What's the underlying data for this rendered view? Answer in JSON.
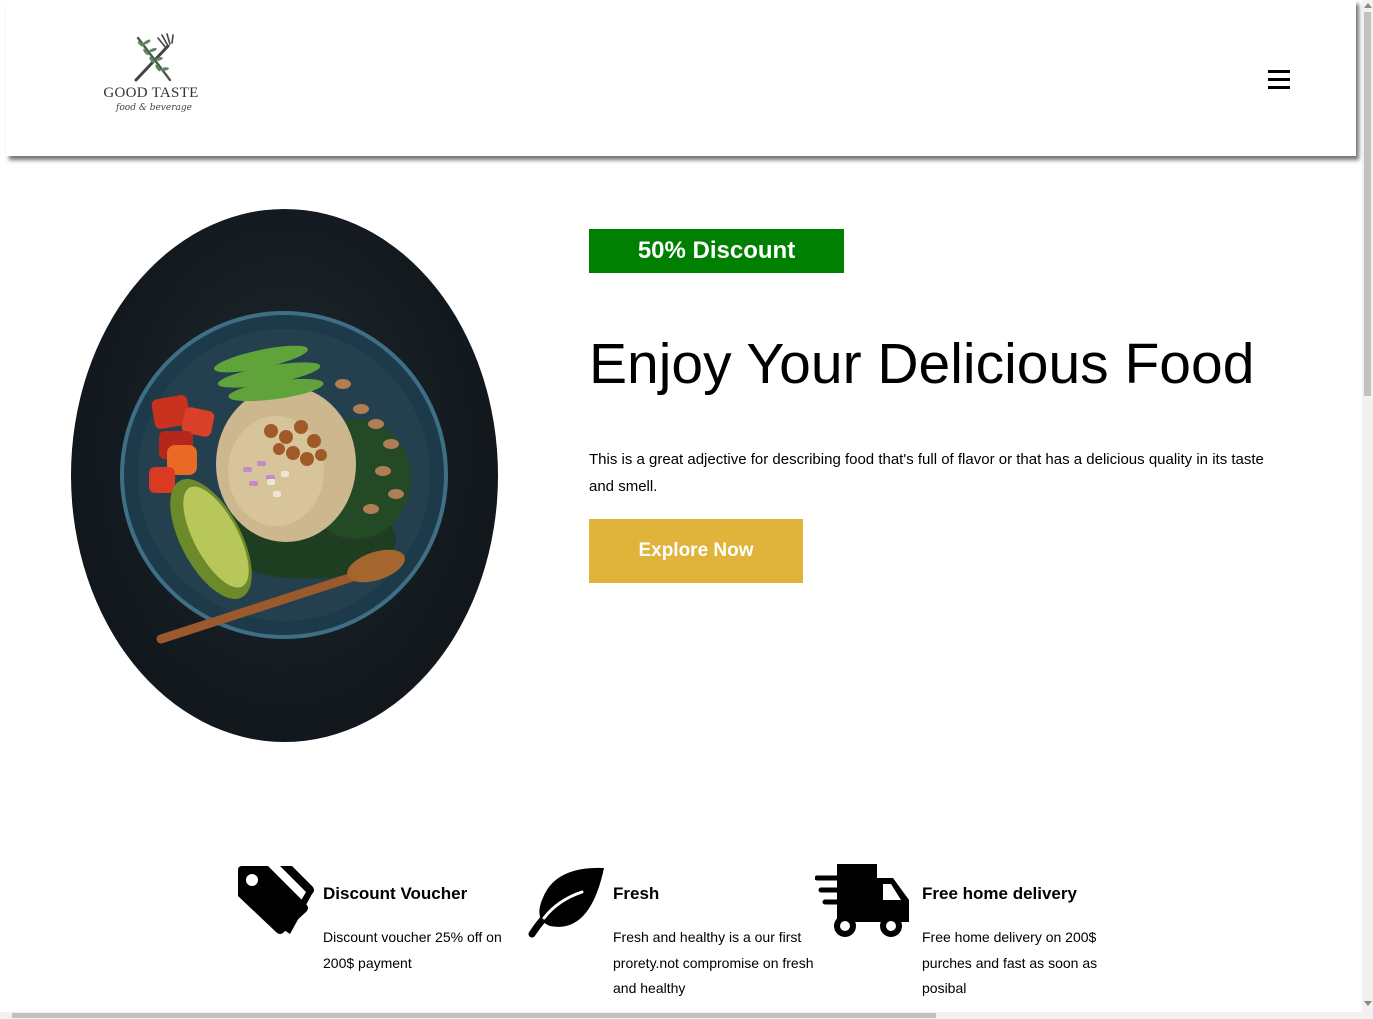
{
  "header": {
    "logo": {
      "name": "GOOD TASTE",
      "tagline": "food & beverage"
    },
    "menu_icon": "hamburger-menu-icon"
  },
  "hero": {
    "image": "food-bowl-image",
    "badge": "50% Discount",
    "title": "Enjoy Your Delicious Food",
    "description": "This is a great adjective for describing food that's full of flavor or that has a delicious quality in its taste and smell.",
    "cta_label": "Explore Now"
  },
  "features": [
    {
      "icon": "price-tags-icon",
      "title": "Discount Voucher",
      "description": "Discount voucher 25% off on 200$ payment"
    },
    {
      "icon": "leaf-icon",
      "title": "Fresh",
      "description": "Fresh and healthy is a our first prorety.not compromise on fresh and healthy"
    },
    {
      "icon": "delivery-truck-icon",
      "title": "Free home delivery",
      "description": "Free home delivery on 200$ purches and fast as soon as posibal"
    }
  ],
  "colors": {
    "badge_bg": "#008000",
    "cta_bg": "#e0b43a",
    "text": "#000000",
    "background": "#ffffff"
  }
}
